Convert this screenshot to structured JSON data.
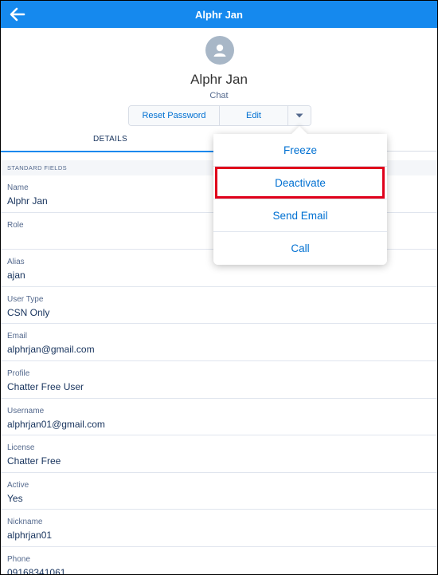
{
  "header": {
    "title": "Alphr Jan",
    "back_icon": "arrow-left-icon",
    "color": "#1589ee"
  },
  "profile": {
    "name": "Alphr Jan",
    "subtitle": "Chat",
    "avatar_icon": "user-avatar-icon"
  },
  "actions": {
    "reset_password": "Reset Password",
    "edit": "Edit",
    "more_icon": "caret-down-icon"
  },
  "tabs": {
    "details": "DETAILS"
  },
  "section": {
    "title": "STANDARD FIELDS"
  },
  "fields": [
    {
      "label": "Name",
      "value": "Alphr Jan"
    },
    {
      "label": "Role",
      "value": ""
    },
    {
      "label": "Alias",
      "value": "ajan"
    },
    {
      "label": "User Type",
      "value": "CSN Only"
    },
    {
      "label": "Email",
      "value": "alphrjan@gmail.com"
    },
    {
      "label": "Profile",
      "value": "Chatter Free User"
    },
    {
      "label": "Username",
      "value": "alphrjan01@gmail.com"
    },
    {
      "label": "License",
      "value": "Chatter Free"
    },
    {
      "label": "Active",
      "value": "Yes"
    },
    {
      "label": "Nickname",
      "value": "alphrjan01"
    },
    {
      "label": "Phone",
      "value": "09168341061"
    }
  ],
  "menu": {
    "items": [
      {
        "label": "Freeze"
      },
      {
        "label": "Deactivate",
        "highlighted": true
      },
      {
        "label": "Send Email"
      },
      {
        "label": "Call"
      }
    ],
    "highlight_color": "#e0001b"
  }
}
